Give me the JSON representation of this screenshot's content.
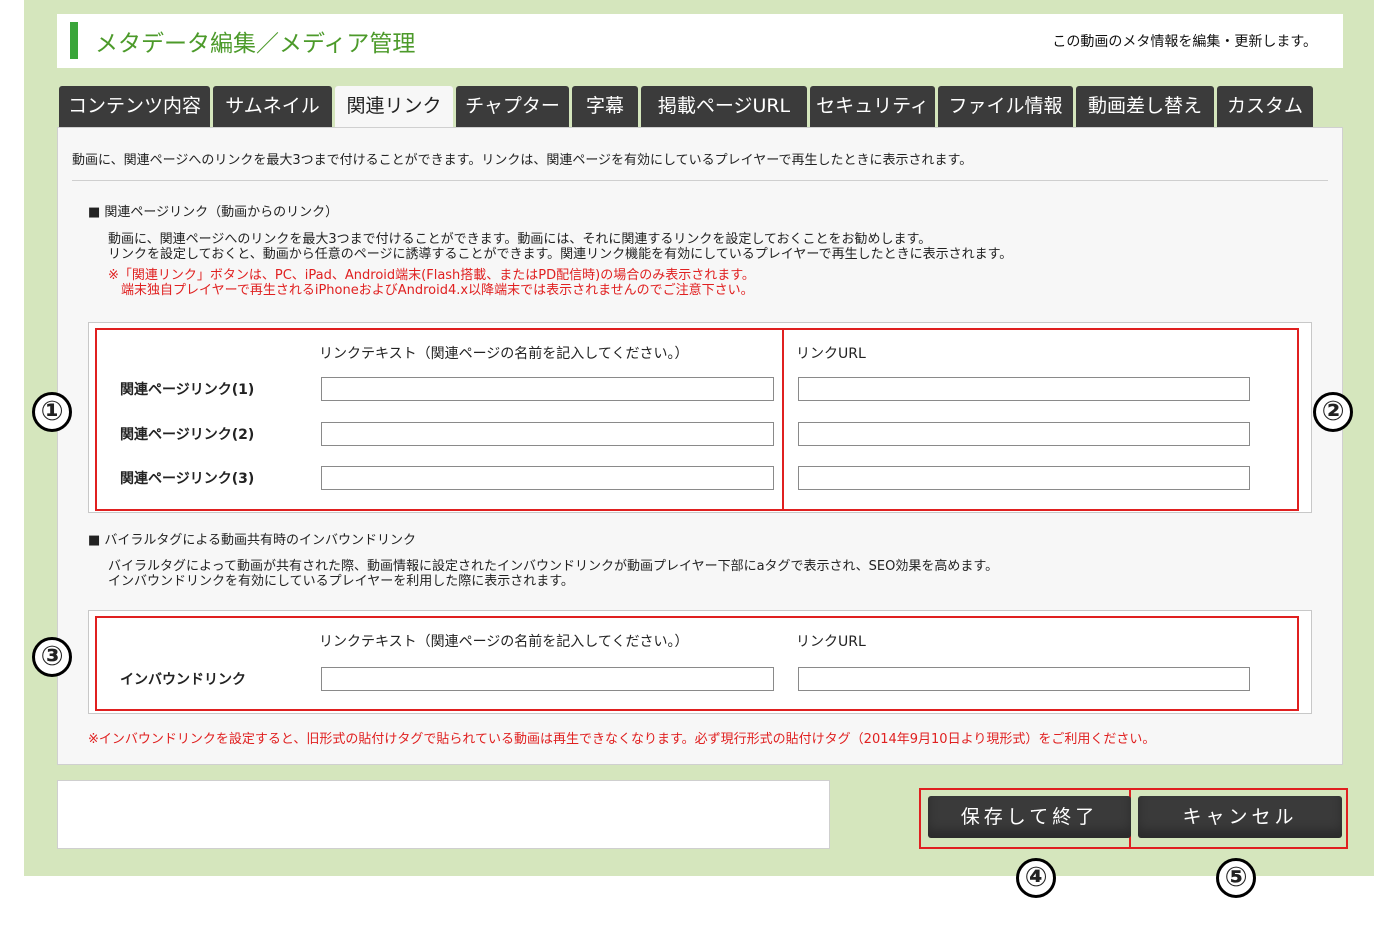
{
  "header": {
    "title": "メタデータ編集／メディア管理",
    "description": "この動画のメタ情報を編集・更新します。"
  },
  "tabs": [
    {
      "label": "コンテンツ内容",
      "active": false
    },
    {
      "label": "サムネイル",
      "active": false
    },
    {
      "label": "関連リンク",
      "active": true
    },
    {
      "label": "チャプター",
      "active": false
    },
    {
      "label": "字幕",
      "active": false
    },
    {
      "label": "掲載ページURL",
      "active": false
    },
    {
      "label": "セキュリティ",
      "active": false
    },
    {
      "label": "ファイル情報",
      "active": false
    },
    {
      "label": "動画差し替え",
      "active": false
    },
    {
      "label": "カスタム",
      "active": false
    }
  ],
  "panel": {
    "intro": "動画に、関連ページへのリンクを最大3つまで付けることができます。リンクは、関連ページを有効にしているプレイヤーで再生したときに表示されます。",
    "related": {
      "heading": "■ 関連ページリンク（動画からのリンク）",
      "desc1": "動画に、関連ページへのリンクを最大3つまで付けることができます。動画には、それに関連するリンクを設定しておくことをお勧めします。",
      "desc2": "リンクを設定しておくと、動画から任意のページに誘導することができます。関連リンク機能を有効にしているプレイヤーで再生したときに表示されます。",
      "note1": "※「関連リンク」ボタンは、PC、iPad、Android端末(Flash搭載、またはPD配信時)の場合のみ表示されます。",
      "note2": "　端末独自プレイヤーで再生されるiPhoneおよびAndroid4.x以降端末では表示されませんのでご注意下さい。",
      "col_text": "リンクテキスト（関連ページの名前を記入してください。）",
      "col_url": "リンクURL",
      "rows": [
        {
          "label": "関連ページリンク(1)",
          "text_value": "",
          "url_value": ""
        },
        {
          "label": "関連ページリンク(2)",
          "text_value": "",
          "url_value": ""
        },
        {
          "label": "関連ページリンク(3)",
          "text_value": "",
          "url_value": ""
        }
      ]
    },
    "inbound": {
      "heading": "■ バイラルタグによる動画共有時のインバウンドリンク",
      "desc1": "バイラルタグによって動画が共有された際、動画情報に設定されたインバウンドリンクが動画プレイヤー下部にaタグで表示され、SEO効果を高めます。",
      "desc2": "インバウンドリンクを有効にしているプレイヤーを利用した際に表示されます。",
      "col_text": "リンクテキスト（関連ページの名前を記入してください。）",
      "col_url": "リンクURL",
      "row_label": "インバウンドリンク",
      "text_value": "",
      "url_value": ""
    },
    "footnote": "※インバウンドリンクを設定すると、旧形式の貼付けタグで貼られている動画は再生できなくなります。必ず現行形式の貼付けタグ（2014年9月10日より現形式）をご利用ください。"
  },
  "buttons": {
    "save": "保存して終了",
    "cancel": "キャンセル"
  },
  "markers": [
    "①",
    "②",
    "③",
    "④",
    "⑤"
  ],
  "colors": {
    "frame": "#d5e6bd",
    "accent": "#3aa53a",
    "highlight": "#e02020",
    "tab_dark": "#3b3b3b"
  }
}
